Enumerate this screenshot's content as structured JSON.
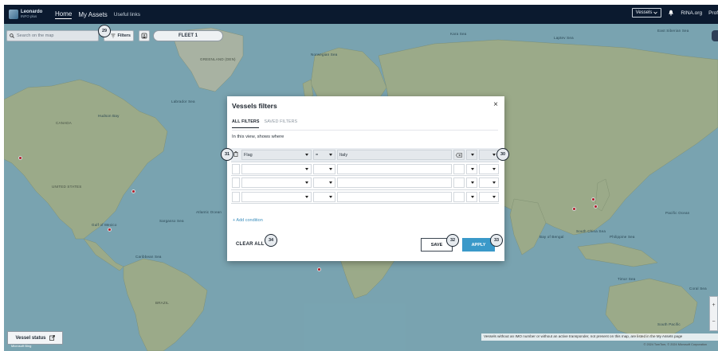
{
  "header": {
    "logo_line1": "Leonardo",
    "logo_line2": "INFO plus",
    "nav": [
      "Home",
      "My Assets",
      "Useful links"
    ],
    "vessels_select": "Vessels",
    "org": "RINA.org",
    "profile": "Prof"
  },
  "map_toolbar": {
    "search_placeholder": "Search on the map",
    "filters_label": "Filters",
    "fleet_label": "FLEET 1"
  },
  "map": {
    "labels": {
      "canada": "CANADA",
      "usa": "UNITED STATES",
      "atlantic": "Atlantic Ocean",
      "greenland": "GREENLAND (DEN)",
      "hudson": "Hudson Bay",
      "gulf": "Gulf of Mexico",
      "caribbean": "Caribbean Sea",
      "norwegian": "Norwegian Sea",
      "brazil": "BRAZIL",
      "arabian": "Arabian Sea",
      "philippine": "Philippine Sea",
      "pacific": "Pacific Ocean",
      "kara": "Kara Sea",
      "laptev": "Laptev Sea",
      "east_siberian": "East Siberian Sea",
      "beaufort": "Beaufort Sea",
      "labrador": "Labrador Sea",
      "sargasso": "Sargasso Sea",
      "bay_bengal": "Bay of Bengal",
      "south_china": "South China Sea",
      "coral": "Coral Sea",
      "timor": "Timor Sea",
      "south_pacific": "South Pacific"
    },
    "vessel_status_label": "Vessel status",
    "note": "Vessels without an IMO number or without an active transponder, not present on this map, are listed in the My Assets page",
    "copyright": "© 2024 TomTom, © 2024 Microsoft Corporation",
    "brand": "Microsoft Bing",
    "zoom_in": "+",
    "zoom_out": "−"
  },
  "modal": {
    "title": "Vessels filters",
    "close": "×",
    "tabs": [
      "ALL FILTERS",
      "SAVED FILTERS"
    ],
    "subtitle": "In this view, shows where",
    "rows": [
      {
        "field": "Flag",
        "operator": "=",
        "value": "Italy"
      },
      {
        "field": "",
        "operator": "",
        "value": ""
      },
      {
        "field": "",
        "operator": "",
        "value": ""
      },
      {
        "field": "",
        "operator": "",
        "value": ""
      }
    ],
    "add_condition": "+ Add condition",
    "clear_all": "CLEAR ALL",
    "save": "SAVE",
    "apply": "APPLY"
  },
  "annotations": [
    "29",
    "30",
    "31",
    "32",
    "33",
    "34"
  ],
  "colors": {
    "topbar": "#0b1a2f",
    "water": "#8fc1cf",
    "land": "#b7c9a0",
    "accent": "#3a99c9",
    "vessel_dot": "#d21f2b"
  }
}
